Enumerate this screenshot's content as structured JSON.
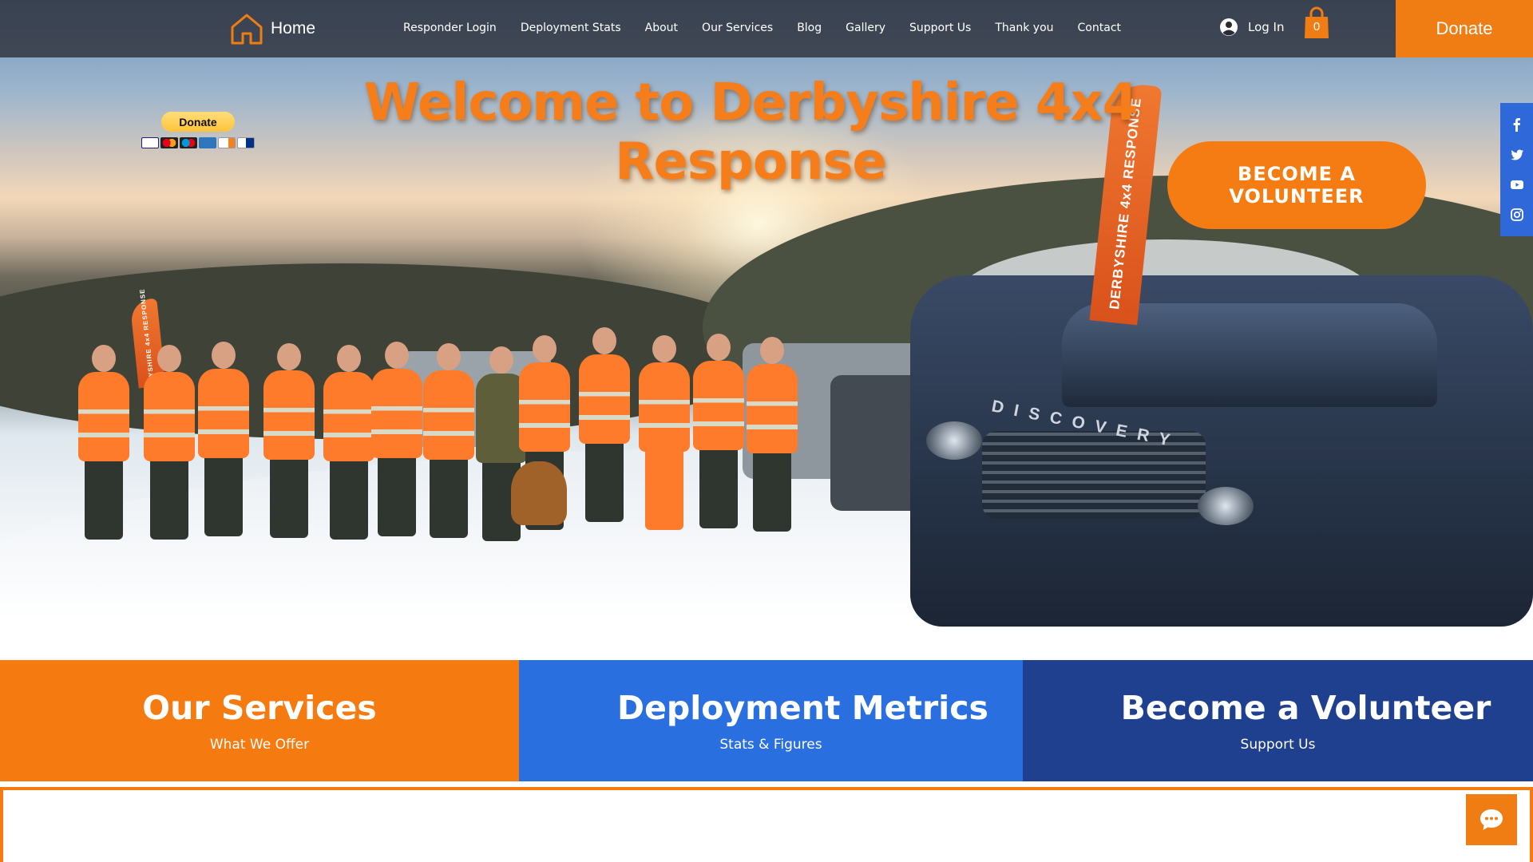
{
  "nav": {
    "home_label": "Home",
    "items": [
      "Responder Login",
      "Deployment Stats",
      "About",
      "Our Services",
      "Blog",
      "Gallery",
      "Support Us",
      "Thank you",
      "Contact"
    ],
    "login_label": "Log In",
    "cart_count": "0",
    "donate_label": "Donate"
  },
  "paypal": {
    "button_label": "Donate",
    "cards": [
      "visa-icon",
      "mastercard-icon",
      "maestro-icon",
      "amex-icon",
      "discover-icon",
      "paypal-credit-icon"
    ]
  },
  "hero": {
    "title_line1": "Welcome to Derbyshire 4x4",
    "title_line2": "Response",
    "volunteer_button": "BECOME A VOLUNTEER",
    "vehicle_brand": "DISCOVERY",
    "flag_text": "DERBYSHIRE 4x4 RESPONSE"
  },
  "social": [
    "facebook-icon",
    "twitter-icon",
    "youtube-icon",
    "instagram-icon"
  ],
  "features": [
    {
      "title": "Our Services",
      "subtitle": "What We Offer"
    },
    {
      "title": "Deployment Metrics",
      "subtitle": "Stats & Figures"
    },
    {
      "title": "Become a Volunteer",
      "subtitle": "Support Us"
    }
  ],
  "colors": {
    "accent_orange": "#f57a10",
    "blue": "#2a6fe0",
    "navy": "#1f3f8f",
    "nav_bg": "#2a2c34"
  }
}
